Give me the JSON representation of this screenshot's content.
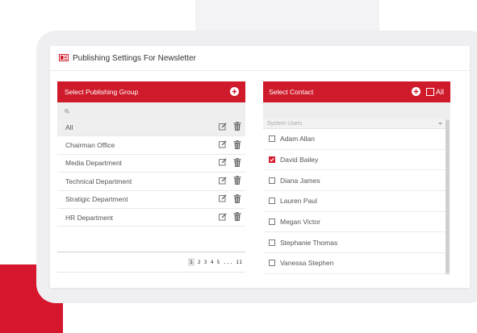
{
  "header": {
    "title": "Publishing Settings For Newsletter"
  },
  "groups_panel": {
    "title": "Select Publishing Group",
    "items": [
      {
        "label": "All",
        "selected": true
      },
      {
        "label": "Chairman Office"
      },
      {
        "label": "Media Department"
      },
      {
        "label": "Technical Department"
      },
      {
        "label": "Stratigic Department"
      },
      {
        "label": "HR Department"
      }
    ],
    "pagination": [
      "1",
      "2",
      "3",
      "4",
      "5",
      "...",
      "11"
    ],
    "current_page": "1"
  },
  "contacts_panel": {
    "title": "Select Contact",
    "all_label": "All",
    "group_label": "System Users",
    "contacts": [
      {
        "name": "Adam Allan",
        "checked": false
      },
      {
        "name": "David Bailey",
        "checked": true
      },
      {
        "name": "Diana James",
        "checked": false
      },
      {
        "name": "Lauren Paul",
        "checked": false
      },
      {
        "name": "Megan Victor",
        "checked": false
      },
      {
        "name": "Stephanie Thomas",
        "checked": false
      },
      {
        "name": "Vanessa Stephen",
        "checked": false
      }
    ]
  },
  "colors": {
    "accent": "#cf1a2b",
    "icon": "#666666"
  }
}
